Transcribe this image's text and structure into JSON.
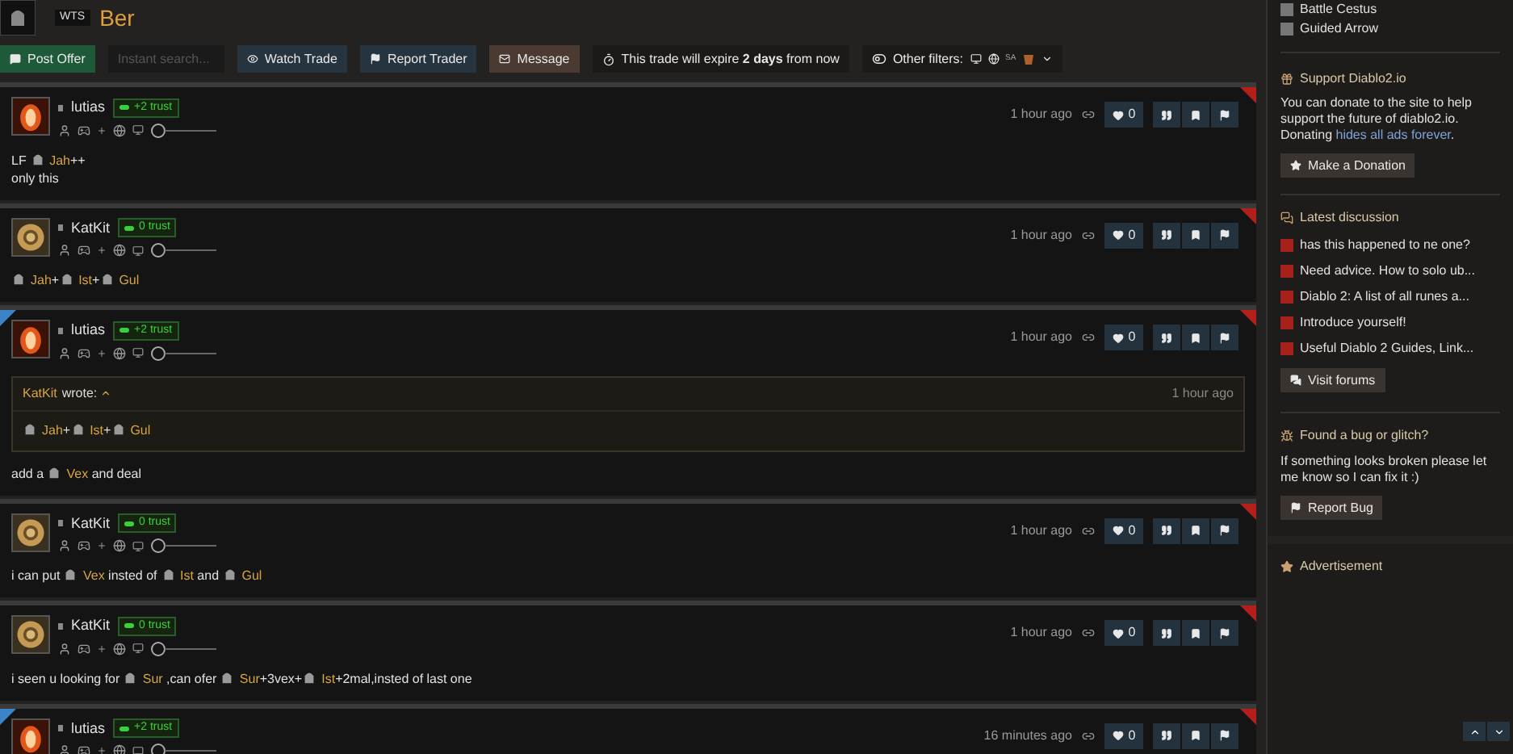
{
  "header": {
    "badge": "WTS",
    "title": "Ber"
  },
  "toolbar": {
    "post_offer": "Post Offer",
    "search": {
      "placeholder": "Instant search..."
    },
    "watch": "Watch Trade",
    "report": "Report Trader",
    "message": "Message",
    "expire": "This trade will expire **2 days** from now",
    "filters": "Other filters:",
    "filter_tag": "SA"
  },
  "posts": [
    {
      "user": "lutias",
      "avatar": {
        "kind": "fire"
      },
      "trust": "+2 trust",
      "time": "1 hour ago",
      "likes": "0",
      "highlighted": false,
      "body": [
        [
          {
            "kind": "text",
            "text": "LF "
          },
          {
            "kind": "rune",
            "text": "Jah"
          },
          {
            "kind": "text",
            "text": "++"
          }
        ],
        [
          {
            "kind": "text",
            "text": "only this"
          }
        ]
      ]
    },
    {
      "user": "KatKit",
      "avatar": {
        "kind": "ring"
      },
      "trust": "0 trust",
      "time": "1 hour ago",
      "likes": "0",
      "highlighted": false,
      "body": [
        [
          {
            "kind": "rune",
            "text": "Jah"
          },
          {
            "kind": "text",
            "text": "+"
          },
          {
            "kind": "rune",
            "text": "Ist"
          },
          {
            "kind": "text",
            "text": "+"
          },
          {
            "kind": "rune",
            "text": "Gul"
          }
        ]
      ]
    },
    {
      "user": "lutias",
      "avatar": {
        "kind": "fire"
      },
      "trust": "+2 trust",
      "time": "1 hour ago",
      "likes": "0",
      "highlighted": true,
      "quote": {
        "author": "KatKit",
        "wrote": "wrote:",
        "time": "1 hour ago",
        "body": [
          {
            "kind": "rune",
            "text": "Jah"
          },
          {
            "kind": "text",
            "text": "+"
          },
          {
            "kind": "rune",
            "text": "Ist"
          },
          {
            "kind": "text",
            "text": "+"
          },
          {
            "kind": "rune",
            "text": "Gul"
          }
        ]
      },
      "body": [
        [
          {
            "kind": "text",
            "text": "add a "
          },
          {
            "kind": "rune",
            "text": "Vex"
          },
          {
            "kind": "text",
            "text": " and deal"
          }
        ]
      ]
    },
    {
      "user": "KatKit",
      "avatar": {
        "kind": "ring"
      },
      "trust": "0 trust",
      "time": "1 hour ago",
      "likes": "0",
      "highlighted": false,
      "body": [
        [
          {
            "kind": "text",
            "text": "i can put "
          },
          {
            "kind": "rune",
            "text": "Vex"
          },
          {
            "kind": "text",
            "text": " insted of "
          },
          {
            "kind": "rune",
            "text": "Ist"
          },
          {
            "kind": "text",
            "text": " and "
          },
          {
            "kind": "rune",
            "text": "Gul"
          }
        ]
      ]
    },
    {
      "user": "KatKit",
      "avatar": {
        "kind": "ring"
      },
      "trust": "0 trust",
      "time": "1 hour ago",
      "likes": "0",
      "highlighted": false,
      "body": [
        [
          {
            "kind": "text",
            "text": "i seen u looking for "
          },
          {
            "kind": "rune",
            "text": "Sur"
          },
          {
            "kind": "text",
            "text": " ,can ofer "
          },
          {
            "kind": "rune",
            "text": "Sur"
          },
          {
            "kind": "text",
            "text": "+3vex+"
          },
          {
            "kind": "rune",
            "text": "Ist"
          },
          {
            "kind": "text",
            "text": "+2mal,insted of last one"
          }
        ]
      ]
    },
    {
      "user": "lutias",
      "avatar": {
        "kind": "fire"
      },
      "trust": "+2 trust",
      "time": "16 minutes ago",
      "likes": "0",
      "highlighted": true
    }
  ],
  "sidebar": {
    "items": [
      "Battle Cestus",
      "Guided Arrow"
    ],
    "support": {
      "title": "Support Diablo2.io",
      "text": "You can donate to the site to help support the future of diablo2.io. Donating ",
      "link": "hides all ads forever",
      "end": ".",
      "button": "Make a Donation"
    },
    "discussion": {
      "title": "Latest discussion",
      "topics": [
        "has this happened to ne one?",
        "Need advice. How to solo ub...",
        "Diablo 2: A list of all runes a...",
        "Introduce yourself!",
        "Useful Diablo 2 Guides, Link..."
      ],
      "button": "Visit forums"
    },
    "bug": {
      "title": "Found a bug or glitch?",
      "text": "If something looks broken please let me know so I can fix it :)",
      "button": "Report Bug"
    },
    "ad": {
      "title": "Advertisement"
    }
  }
}
